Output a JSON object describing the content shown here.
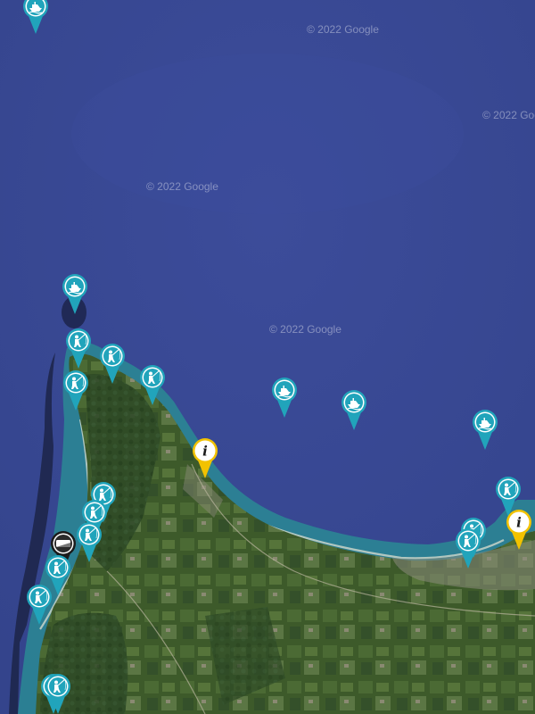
{
  "map": {
    "attribution": "© 2022 Google",
    "colors": {
      "sea": "#3a4a96",
      "shallow": "#2a8a94",
      "land": "#3d5a2a",
      "pin_teal": "#21a4bb",
      "pin_info": "#f2c200"
    }
  },
  "markers": [
    {
      "type": "boat",
      "icon": "boat-icon"
    },
    {
      "type": "boat",
      "icon": "boat-icon"
    },
    {
      "type": "fishing",
      "icon": "angler-icon"
    },
    {
      "type": "fishing",
      "icon": "angler-icon"
    },
    {
      "type": "fishing",
      "icon": "angler-icon"
    },
    {
      "type": "fishing",
      "icon": "angler-icon"
    },
    {
      "type": "boat",
      "icon": "boat-icon"
    },
    {
      "type": "boat",
      "icon": "boat-icon"
    },
    {
      "type": "boat",
      "icon": "boat-icon"
    },
    {
      "type": "info",
      "icon": "info-icon"
    },
    {
      "type": "fishing",
      "icon": "angler-icon"
    },
    {
      "type": "info",
      "icon": "info-icon"
    },
    {
      "type": "fishing",
      "icon": "angler-icon"
    },
    {
      "type": "fishing",
      "icon": "angler-icon"
    },
    {
      "type": "fishing",
      "icon": "angler-icon"
    },
    {
      "type": "boat-ramp",
      "icon": "boat-ramp-icon"
    },
    {
      "type": "fishing",
      "icon": "angler-icon"
    },
    {
      "type": "fishing",
      "icon": "angler-icon"
    },
    {
      "type": "fishing",
      "icon": "angler-icon"
    },
    {
      "type": "fishing",
      "icon": "angler-icon"
    },
    {
      "type": "fishing",
      "icon": "angler-icon"
    },
    {
      "type": "fishing",
      "icon": "angler-icon"
    }
  ]
}
